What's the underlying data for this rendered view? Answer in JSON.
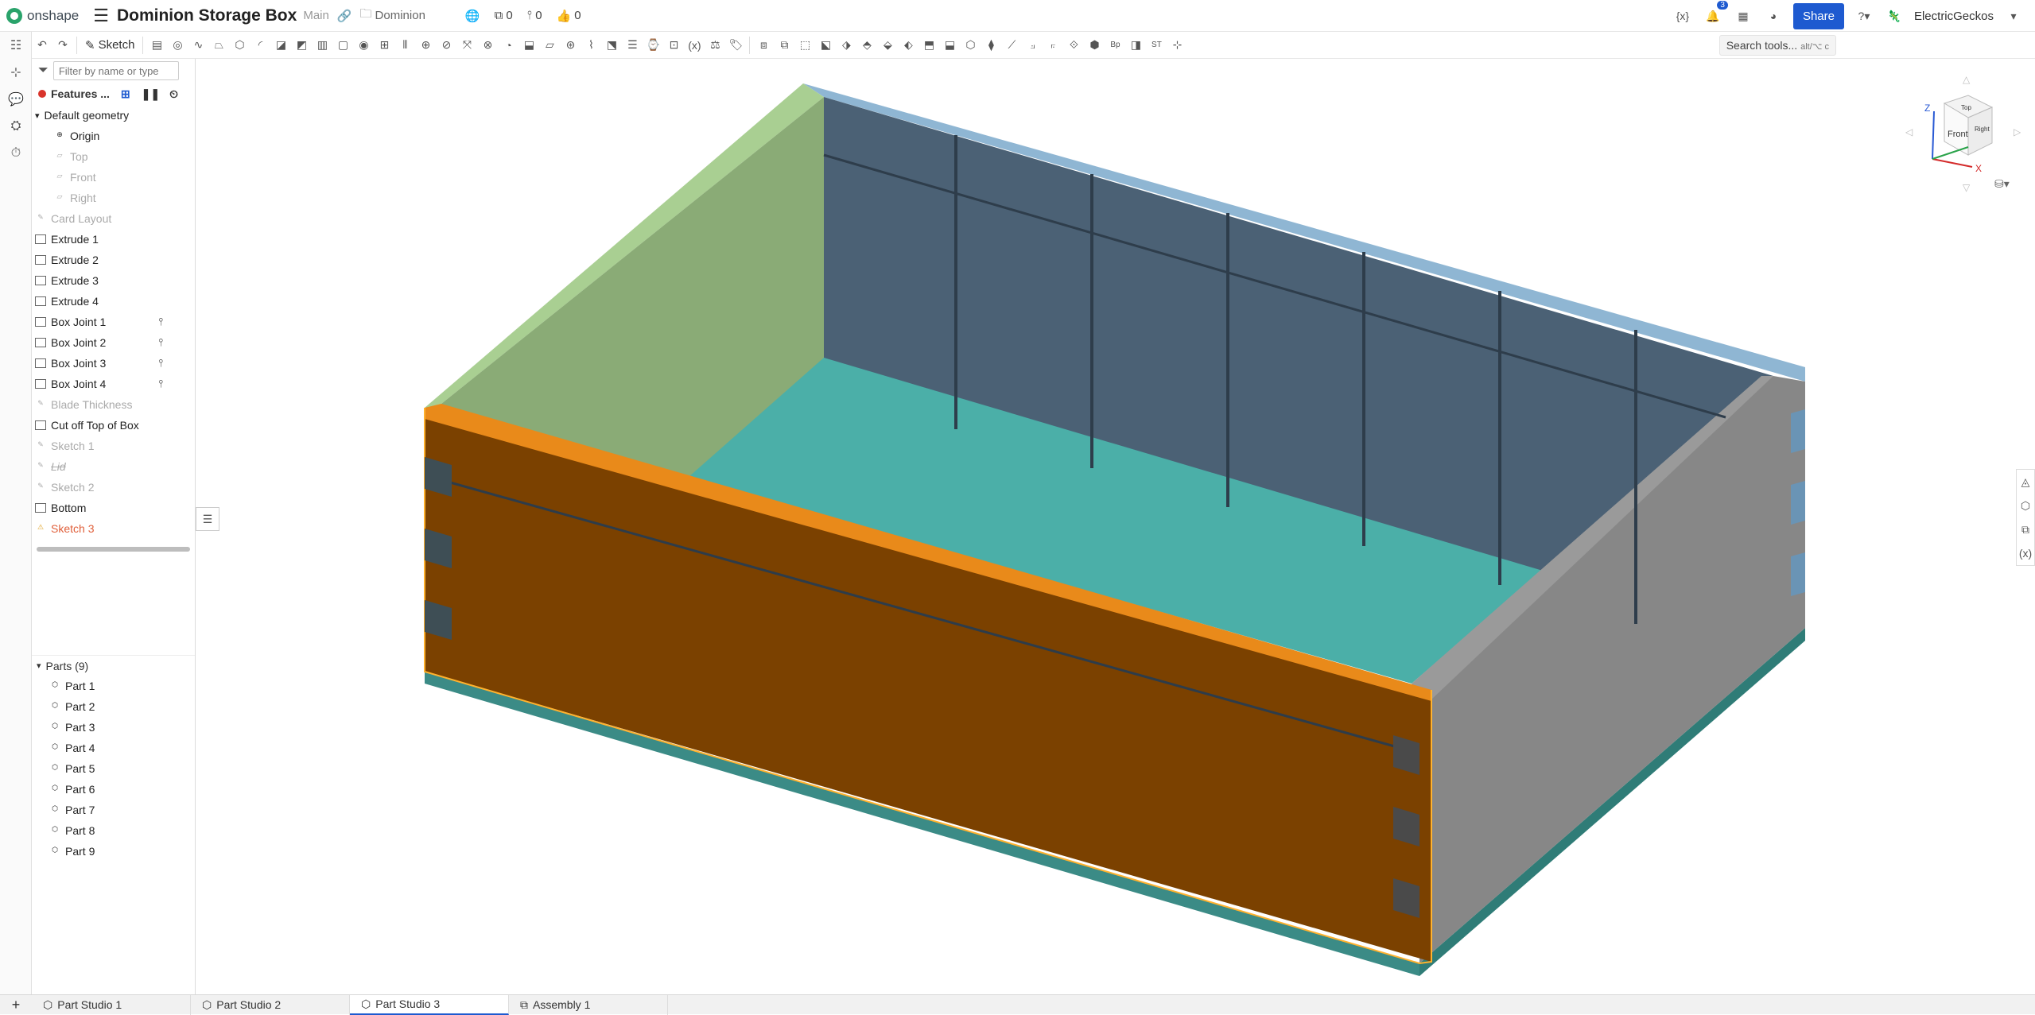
{
  "app": {
    "name": "onshape"
  },
  "document": {
    "title": "Dominion Storage Box",
    "branch": "Main",
    "folder": "Dominion"
  },
  "counters": {
    "versions": "0",
    "branches": "0",
    "likes": "0"
  },
  "header": {
    "notifications": "3",
    "share_label": "Share",
    "user": "ElectricGeckos"
  },
  "toolbar": {
    "sketch_label": "Sketch",
    "search_label": "Search tools...",
    "search_shortcut": "alt/⌥ c"
  },
  "feature_panel": {
    "filter_placeholder": "Filter by name or type",
    "header_label": "Features ...",
    "default_geometry": "Default geometry",
    "default_items": [
      "Origin",
      "Top",
      "Front",
      "Right"
    ],
    "features": [
      {
        "label": "Card Layout",
        "state": "dim",
        "icon": "sketch-icon"
      },
      {
        "label": "Extrude 1",
        "state": "normal",
        "icon": "extrude-icon"
      },
      {
        "label": "Extrude 2",
        "state": "normal",
        "icon": "extrude-icon"
      },
      {
        "label": "Extrude 3",
        "state": "normal",
        "icon": "extrude-icon"
      },
      {
        "label": "Extrude 4",
        "state": "normal",
        "icon": "extrude-icon"
      },
      {
        "label": "Box Joint 1",
        "state": "normal",
        "icon": "box-joint-icon",
        "pinned": true
      },
      {
        "label": "Box Joint 2",
        "state": "normal",
        "icon": "box-joint-icon",
        "pinned": true
      },
      {
        "label": "Box Joint 3",
        "state": "normal",
        "icon": "box-joint-icon",
        "pinned": true
      },
      {
        "label": "Box Joint 4",
        "state": "normal",
        "icon": "box-joint-icon",
        "pinned": true
      },
      {
        "label": "Blade Thickness",
        "state": "dim",
        "icon": "sketch-icon"
      },
      {
        "label": "Cut off Top of Box",
        "state": "normal",
        "icon": "extrude-icon"
      },
      {
        "label": "Sketch 1",
        "state": "dim",
        "icon": "sketch-icon"
      },
      {
        "label": "Lid",
        "state": "suppressed",
        "icon": "sketch-icon"
      },
      {
        "label": "Sketch 2",
        "state": "dim",
        "icon": "sketch-icon"
      },
      {
        "label": "Bottom",
        "state": "normal",
        "icon": "extrude-icon"
      },
      {
        "label": "Sketch 3",
        "state": "warning",
        "icon": "warning-icon"
      }
    ],
    "parts_header": "Parts (9)",
    "parts": [
      "Part 1",
      "Part 2",
      "Part 3",
      "Part 4",
      "Part 5",
      "Part 6",
      "Part 7",
      "Part 8",
      "Part 9"
    ]
  },
  "view_cube": {
    "front": "Front",
    "top": "Top",
    "right": "Right",
    "axis_x": "X",
    "axis_z": "Z"
  },
  "tabs": [
    {
      "label": "Part Studio 1",
      "active": false
    },
    {
      "label": "Part Studio 2",
      "active": false
    },
    {
      "label": "Part Studio 3",
      "active": true
    },
    {
      "label": "Assembly 1",
      "active": false
    }
  ],
  "colors": {
    "front_panel": "#7b4100",
    "selected_edge": "#e98a1a",
    "back_wall": "#4b6175",
    "left_wall": "#8aab76",
    "right_wall": "#878787",
    "floor": "#4bafa8",
    "top_rim": "#8fb6d3",
    "base_strip": "#3b8b86",
    "accent": "#1e5ad0"
  }
}
